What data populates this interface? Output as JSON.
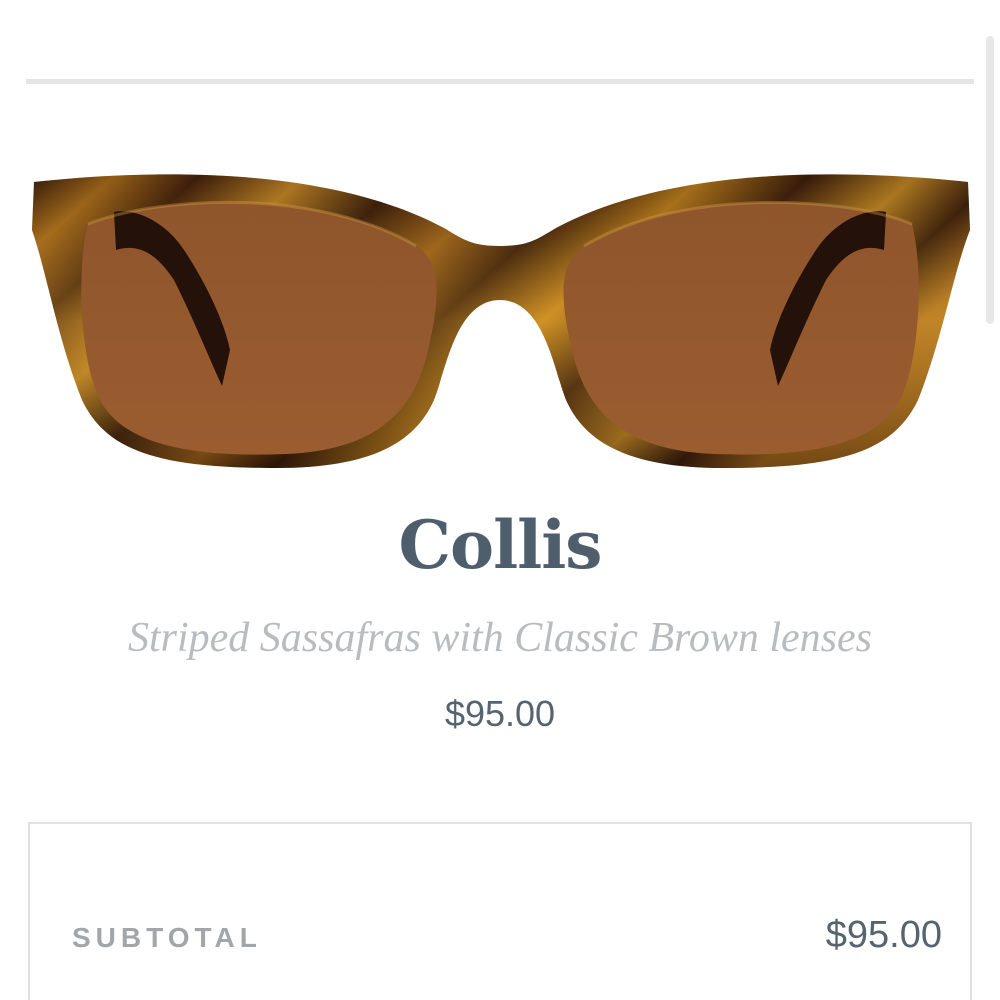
{
  "product": {
    "name": "Collis",
    "variant": "Striped Sassafras with Classic Brown lenses",
    "price": "$95.00",
    "image_icon": "sunglasses-image",
    "colors": {
      "frame_dark": "#2a1408",
      "frame_amber": "#c98a1e",
      "lens": "#94592e"
    }
  },
  "summary": {
    "subtotal_label": "SUBTOTAL",
    "subtotal_value": "$95.00"
  }
}
